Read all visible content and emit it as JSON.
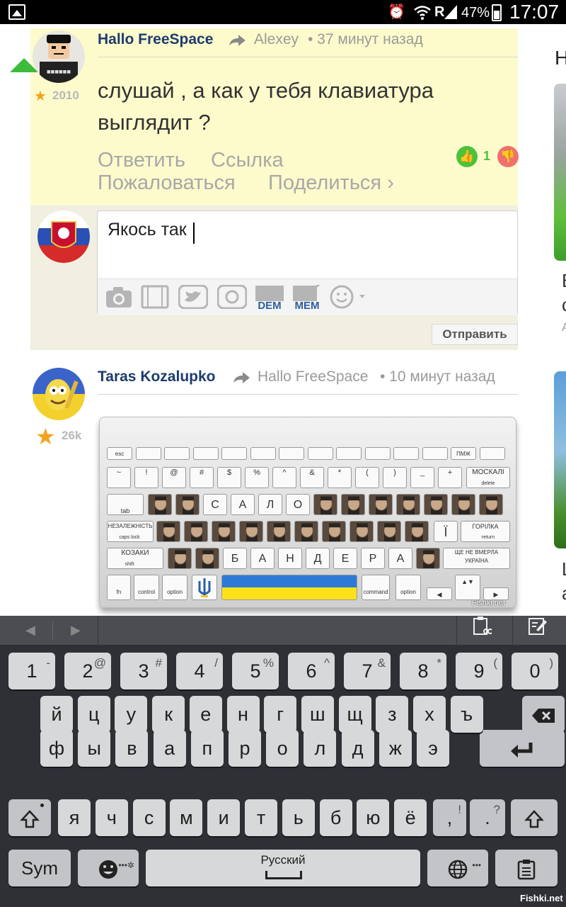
{
  "status_bar": {
    "battery": "47%",
    "time": "17:07",
    "carrier": "R"
  },
  "comment1": {
    "author": "Hallo FreeSpace",
    "reply_to": "Alexey",
    "timestamp": "• 37 минут назад",
    "rating": "2010",
    "text_line1": "слушай , а как у тебя клавиатура",
    "text_line2": "выглядит ?",
    "actions": {
      "reply": "Ответить",
      "link": "Ссылка",
      "report": "Пожаловаться",
      "share": "Поделиться ›"
    },
    "likes": "1"
  },
  "reply_form": {
    "value": "Якось так",
    "toolbar": {
      "dem": "DEM",
      "mem": "MEM"
    },
    "send_label": "Отправить"
  },
  "comment2": {
    "author": "Taras Kozalupko",
    "reply_to": "Hallo FreeSpace",
    "timestamp": "• 10 минут назад",
    "rating": "26k",
    "image_keys": {
      "row1": [
        "esc",
        "",
        "",
        "",
        "",
        "",
        "",
        "",
        "",
        "",
        "",
        "",
        "ПМЖ",
        ""
      ],
      "row2": [
        "~",
        "!",
        "@",
        "#",
        "$",
        "%",
        "^",
        "&",
        "*",
        "(",
        ")",
        "_",
        "+"
      ],
      "row2_last": "МОСКАЛІ",
      "row2_sub": "delete",
      "row3_letters": [
        "С",
        "А",
        "Л",
        "О"
      ],
      "row3_tab": "tab",
      "row4_first": "НЕЗАЛЕЖНІСТЬ",
      "row4_caps": "caps lock",
      "row4_i": "Ї",
      "row4_last": "ГОРІЛКА",
      "row4_sub": "return",
      "row5_first": "КОЗАКИ",
      "row5_shift": "shift",
      "row5_letters": [
        "Б",
        "А",
        "Н",
        "Д",
        "Е",
        "Р",
        "А"
      ],
      "row5_last": "ЩЕ НЕ ВМЕРЛА УКРАЇНА",
      "row6": [
        "fn",
        "control",
        "option",
        "command",
        "option"
      ],
      "watermark": "Fishki.net"
    }
  },
  "keyboard": {
    "row_numbers": [
      {
        "k": "1",
        "s": "-"
      },
      {
        "k": "2",
        "s": "@"
      },
      {
        "k": "3",
        "s": "#"
      },
      {
        "k": "4",
        "s": "/"
      },
      {
        "k": "5",
        "s": "%"
      },
      {
        "k": "6",
        "s": "^"
      },
      {
        "k": "7",
        "s": "&"
      },
      {
        "k": "8",
        "s": "*"
      },
      {
        "k": "9",
        "s": "("
      },
      {
        "k": "0",
        "s": ")"
      }
    ],
    "row1": [
      "й",
      "ц",
      "у",
      "к",
      "е",
      "н",
      "г",
      "ш",
      "щ",
      "з",
      "х",
      "ъ"
    ],
    "row2": [
      "ф",
      "ы",
      "в",
      "а",
      "п",
      "р",
      "о",
      "л",
      "д",
      "ж",
      "э"
    ],
    "row3": [
      "я",
      "ч",
      "с",
      "м",
      "и",
      "т",
      "ь",
      "б",
      "ю",
      "ё"
    ],
    "comma": ",",
    "comma_sup": "!",
    "period": ".",
    "period_sup": "?",
    "sym": "Sym",
    "space_label": "Русский"
  },
  "watermark": "Fishki.net"
}
